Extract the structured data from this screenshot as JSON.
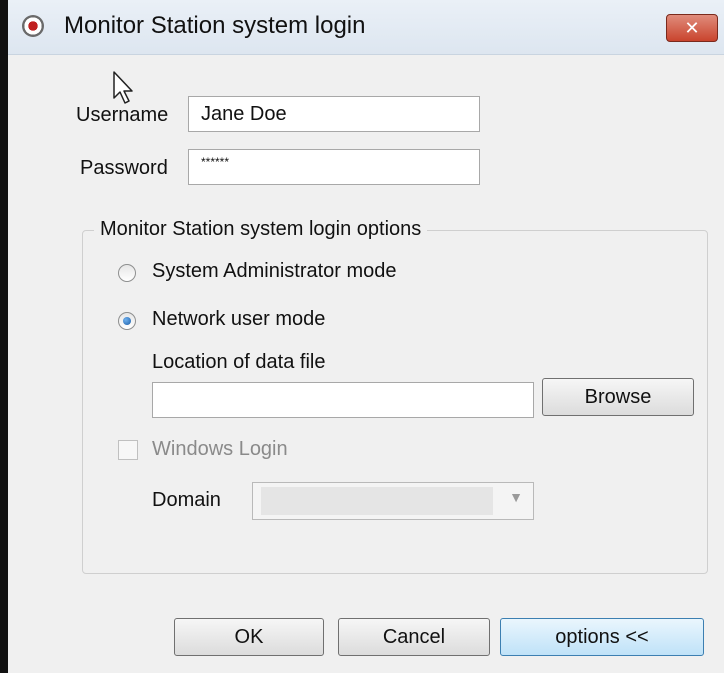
{
  "window": {
    "title": "Monitor Station system login",
    "close_label": "✕"
  },
  "form": {
    "username_label": "Username",
    "username_value": "Jane Doe",
    "password_label": "Password",
    "password_value": "******"
  },
  "options_group": {
    "title": "Monitor Station system login options",
    "radio_admin_label": "System Administrator mode",
    "radio_network_label": "Network user mode",
    "selected_mode": "Network user mode",
    "data_file_label": "Location of data file",
    "data_file_value": "",
    "browse_label": "Browse",
    "windows_login_label": "Windows Login",
    "windows_login_checked": false,
    "domain_label": "Domain",
    "domain_value": ""
  },
  "buttons": {
    "ok": "OK",
    "cancel": "Cancel",
    "options": "options <<"
  },
  "icons": [
    "app-eye-icon",
    "close-icon",
    "mouse-cursor-icon",
    "chevron-down-icon"
  ],
  "colors": {
    "close_button": "#c9442d",
    "radio_selected": "#1c5fa8",
    "default_button": "#bfe2f8"
  }
}
